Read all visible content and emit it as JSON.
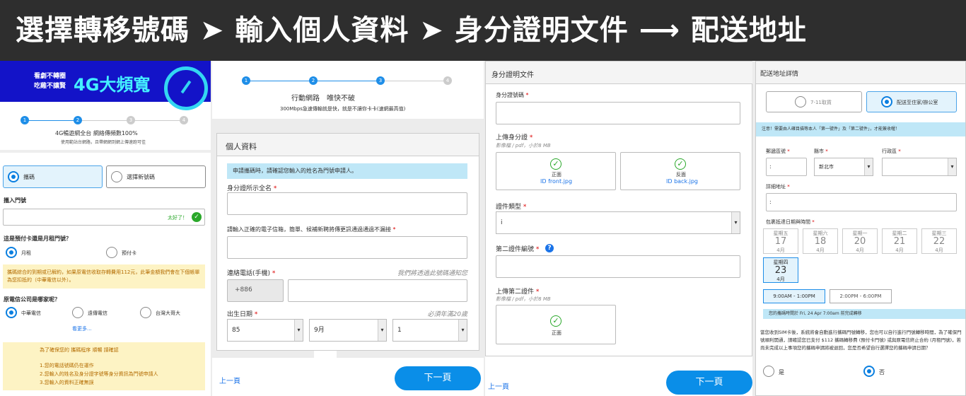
{
  "banner": {
    "text": "選擇轉移號碼 ➤ 輸入個人資料 ➤ 身分證明文件 ⟶ 配送地址"
  },
  "p1": {
    "ad": {
      "line1": "看劇不轉圈",
      "line2": "吃雞不讓賢",
      "big": "4G大頻寬"
    },
    "steps": [
      "1",
      "2",
      "3",
      "4"
    ],
    "step_title": "4G暢遊網全台  網絡傳頻數100%",
    "step_sub": "使用範站台網路，且帶網網到網上傳速跑可佳",
    "opt_keep": "攜碼",
    "opt_new": "選擇新號碼",
    "number_label": "攜入門號",
    "number_ok": "太好了！",
    "q1": "這是預付卡還是月租門號？",
    "q1_a": "月租",
    "q1_b": "預付卡",
    "warn1": "攜碼綜合的到期或已解約，如果原電信收取存轉費用112元，此筆金額我們會在下個帳單為您扣抵的（中華電信以外）。",
    "q2": "原電信公司是哪家呢？",
    "q2_a": "中華電信",
    "q2_b": "遠傳電信",
    "q2_c": "台灣大哥大",
    "more": "看更多...",
    "warn2_title": "為了確保您的 攜碼程序 順暢 請確認",
    "warn2_l1": "1.您的電話號碼仍在運作",
    "warn2_l2": "2.您輸入的姓名及身分證字號等身分資訊為門號申請人",
    "warn2_l3": "3.您輸入的資料正確無誤"
  },
  "p2": {
    "steps": [
      "1",
      "2",
      "3",
      "4"
    ],
    "step_title": "行動網路　唯快不破",
    "step_sub": "300Mbps急速傳輸就是快，就是不讓你卡卡(速網最高值)",
    "section": "個人資料",
    "note": "申請攜碼時，請確認您輸入的姓名為門號申請人。",
    "name_label": "身分證所示全名",
    "name_req": "*",
    "email_label": "請輸入正確的電子信箱，簡單、候補新聘將傳更訊通過通過不漏接",
    "email_req": "*",
    "phone_label": "連絡電話(手機)",
    "phone_req": "*",
    "phone_hint": "我們將透過此號碼通知您",
    "phone_code": "+886",
    "dob_label": "出生日期",
    "dob_req": "*",
    "dob_hint": "必須年滿20歲",
    "dob_y": "85",
    "dob_m": "9月",
    "dob_d": "1",
    "prev": "上一頁",
    "next": "下一頁"
  },
  "p3": {
    "title": "身分證明文件",
    "id_label": "身分證號碼",
    "id_req": "*",
    "upload_label": "上傳身分證",
    "upload_req": "*",
    "upload_hint": "影像檔 / pdf，小於8 MB",
    "front_cap": "正面",
    "front_file": "ID front.jpg",
    "back_cap": "反面",
    "back_file": "ID back.jpg",
    "doc_type_label": "證件類型",
    "doc_type_req": "*",
    "doc_type_val": "i",
    "doc2_label": "第二證件編號",
    "doc2_req": "*",
    "upload2_label": "上傳第二證件",
    "upload2_req": "*",
    "upload2_hint": "影像檔 / pdf，小於8 MB",
    "up2_cap": "正面",
    "prev": "上一頁",
    "next": "下一頁"
  },
  "p4": {
    "title": "配送地址詳情",
    "opt_store": "7-11取貨",
    "opt_home": "配送至住家/辦公室",
    "note": "注意！需要由人確目描等本人「第一號件」及「第二號件」，才能簽收喔！",
    "zip_label": "郵遞區號",
    "zip_req": "*",
    "zip_val": ":",
    "city_label": "縣市",
    "city_req": "*",
    "city_val": "新北市",
    "dist_label": "行政區",
    "dist_req": "*",
    "addr_label": "詳細地址",
    "addr_req": "*",
    "addr_val": ":",
    "date_label": "包裹抵達日期與時間",
    "date_req": "*",
    "dates": [
      {
        "w": "星期五",
        "d": "17",
        "m": "4月"
      },
      {
        "w": "星期六",
        "d": "18",
        "m": "4月"
      },
      {
        "w": "星期一",
        "d": "20",
        "m": "4月"
      },
      {
        "w": "星期二",
        "d": "21",
        "m": "4月"
      },
      {
        "w": "星期三",
        "d": "22",
        "m": "4月"
      }
    ],
    "date_sel": {
      "w": "星期四",
      "d": "23",
      "m": "4月"
    },
    "slot1": "9:00AM - 1:00PM",
    "slot2": "2:00PM - 6:00PM",
    "confirm": "您的攜碼時間於 Fri, 24 Apr 7:00am 前完成轉移",
    "para": "當您收到SIM卡後，系統將會自動進行攜碼門號轉移，您也可以自行進行門號轉移時間，為了確保門號順利開通，請確認您已支付 $112 攜碼轉移費 (預付卡門號) 或與原電信終止合約 (月租門號)，若尚未完成以上事項您的攜碼申請將被退回，您是否希望自行選擇您的攜碼申請日期？",
    "yes": "是",
    "no": "否"
  }
}
